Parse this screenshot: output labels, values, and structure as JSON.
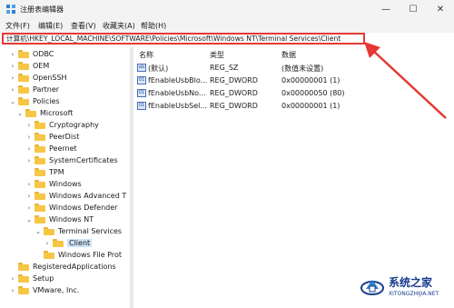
{
  "window": {
    "title": "注册表编辑器",
    "minimize": "—",
    "maximize": "☐",
    "close": "✕"
  },
  "menu": [
    "文件(F)",
    "编辑(E)",
    "查看(V)",
    "收藏夹(A)",
    "帮助(H)"
  ],
  "address": "计算机\\HKEY_LOCAL_MACHINE\\SOFTWARE\\Policies\\Microsoft\\Windows NT\\Terminal Services\\Client",
  "tree": [
    {
      "label": "ODBC",
      "expander": "closed"
    },
    {
      "label": "OEM",
      "expander": "closed"
    },
    {
      "label": "OpenSSH",
      "expander": "closed"
    },
    {
      "label": "Partner",
      "expander": "closed"
    },
    {
      "label": "Policies",
      "expander": "open"
    },
    {
      "label": "Microsoft",
      "expander": "open"
    },
    {
      "label": "Cryptography",
      "expander": "closed"
    },
    {
      "label": "PeerDist",
      "expander": "closed"
    },
    {
      "label": "Peernet",
      "expander": "closed"
    },
    {
      "label": "SystemCertificates",
      "expander": "closed"
    },
    {
      "label": "TPM",
      "expander": "none"
    },
    {
      "label": "Windows",
      "expander": "closed"
    },
    {
      "label": "Windows Advanced T",
      "expander": "closed"
    },
    {
      "label": "Windows Defender",
      "expander": "closed"
    },
    {
      "label": "Windows NT",
      "expander": "open"
    },
    {
      "label": "Terminal Services",
      "expander": "open"
    },
    {
      "label": "Client",
      "expander": "closed",
      "selected": true
    },
    {
      "label": "Windows File Prot",
      "expander": "none"
    },
    {
      "label": "RegisteredApplications",
      "expander": "none"
    },
    {
      "label": "Setup",
      "expander": "closed"
    },
    {
      "label": "VMware, Inc.",
      "expander": "closed"
    }
  ],
  "values_pane": {
    "columns": [
      "名称",
      "类型",
      "数据"
    ],
    "rows": [
      {
        "icon": "ab",
        "name": "(默认)",
        "type": "REG_SZ",
        "data": "(数值未设置)"
      },
      {
        "icon": "01",
        "name": "fEnableUsbBlo...",
        "type": "REG_DWORD",
        "data": "0x00000001 (1)"
      },
      {
        "icon": "01",
        "name": "fEnableUsbNo...",
        "type": "REG_DWORD",
        "data": "0x00000050 (80)"
      },
      {
        "icon": "01",
        "name": "fEnableUsbSel...",
        "type": "REG_DWORD",
        "data": "0x00000001 (1)"
      }
    ]
  },
  "watermark": {
    "title": "系统之家",
    "url": "XITONGZHIJIA.NET"
  },
  "colors": {
    "highlight": "#e53935",
    "selection": "#cce4f7",
    "folder": "#f6c644",
    "brand": "#1a3e8f"
  }
}
